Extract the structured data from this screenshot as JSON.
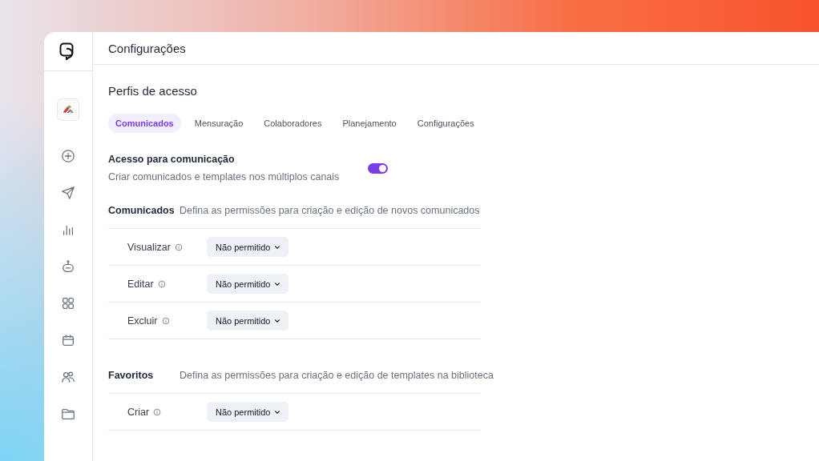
{
  "header": {
    "title": "Configurações"
  },
  "page_title": "Perfis de acesso",
  "tabs": [
    {
      "label": "Comunicados",
      "selected": true
    },
    {
      "label": "Mensuração",
      "selected": false
    },
    {
      "label": "Colaboradores",
      "selected": false
    },
    {
      "label": "Planejamento",
      "selected": false
    },
    {
      "label": "Configurações",
      "selected": false
    }
  ],
  "access": {
    "title": "Acesso para comunicação",
    "description": "Criar comunicados e templates nos múltiplos canais",
    "on": true
  },
  "sections": [
    {
      "title": "Comunicados",
      "description": "Defina as permissões para criação e edição de novos comunicados",
      "rows": [
        {
          "label": "Visualizar",
          "value": "Não permitido"
        },
        {
          "label": "Editar",
          "value": "Não permitido"
        },
        {
          "label": "Excluir",
          "value": "Não permitido"
        }
      ]
    },
    {
      "title": "Favoritos",
      "description": "Defina as permissões para criação e edição de templates na biblioteca",
      "rows": [
        {
          "label": "Criar",
          "value": "Não permitido"
        }
      ]
    }
  ]
}
